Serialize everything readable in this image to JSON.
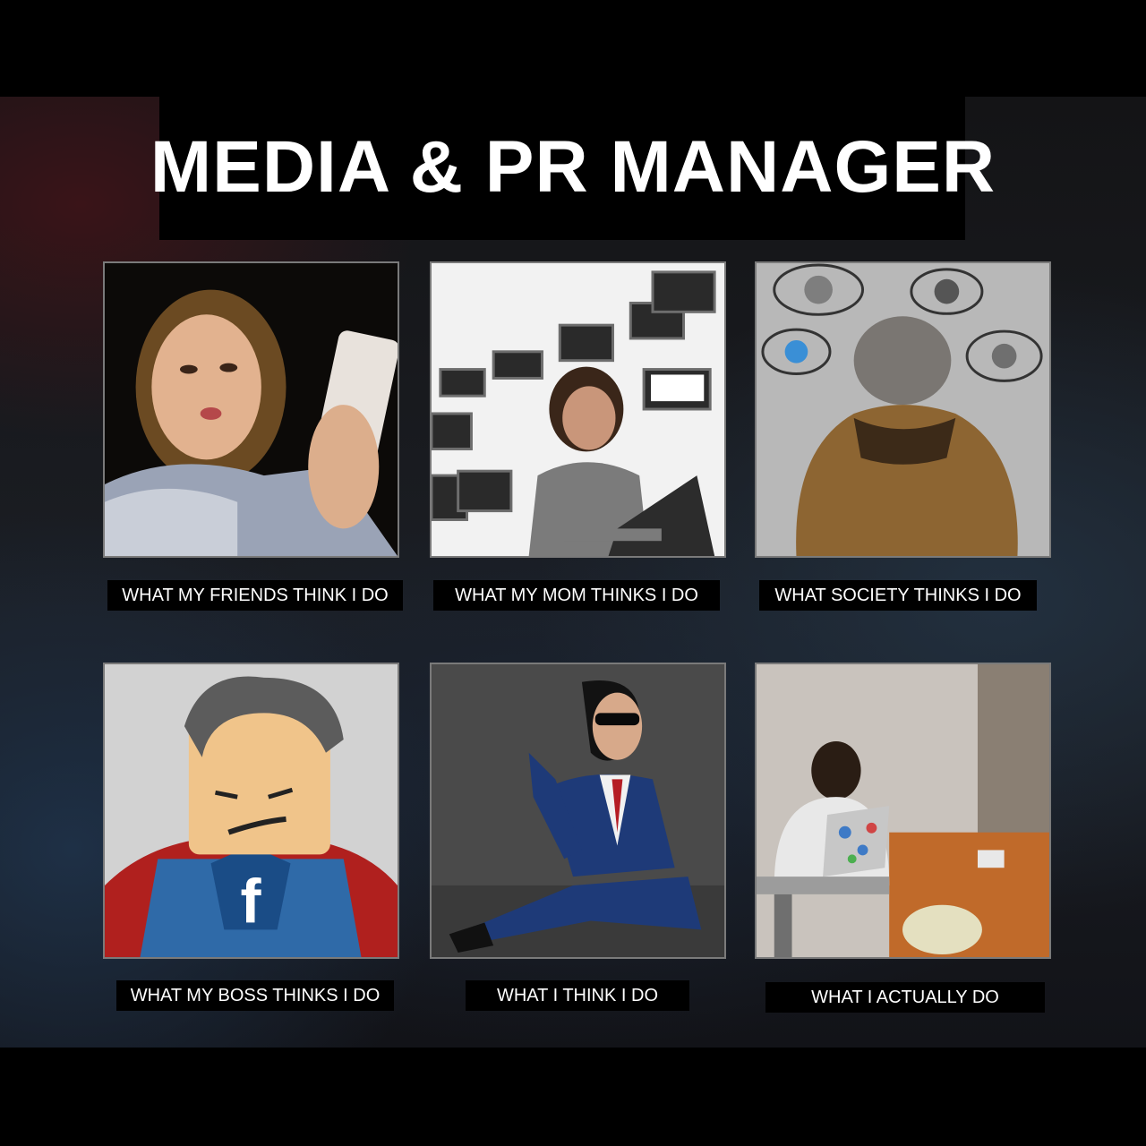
{
  "title": "MEDIA & PR MANAGER",
  "panels": [
    {
      "caption": "WHAT MY FRIENDS THINK I DO"
    },
    {
      "caption": "WHAT MY MOM THINKS I DO"
    },
    {
      "caption": "WHAT SOCIETY THINKS I DO"
    },
    {
      "caption": "WHAT MY BOSS THINKS I DO"
    },
    {
      "caption": "WHAT I THINK I DO"
    },
    {
      "caption": "WHAT I ACTUALLY DO"
    }
  ],
  "colors": {
    "background": "#000000",
    "title": "#ffffff",
    "caption": "#ffffff",
    "panel_border": "#7a7a7a"
  }
}
